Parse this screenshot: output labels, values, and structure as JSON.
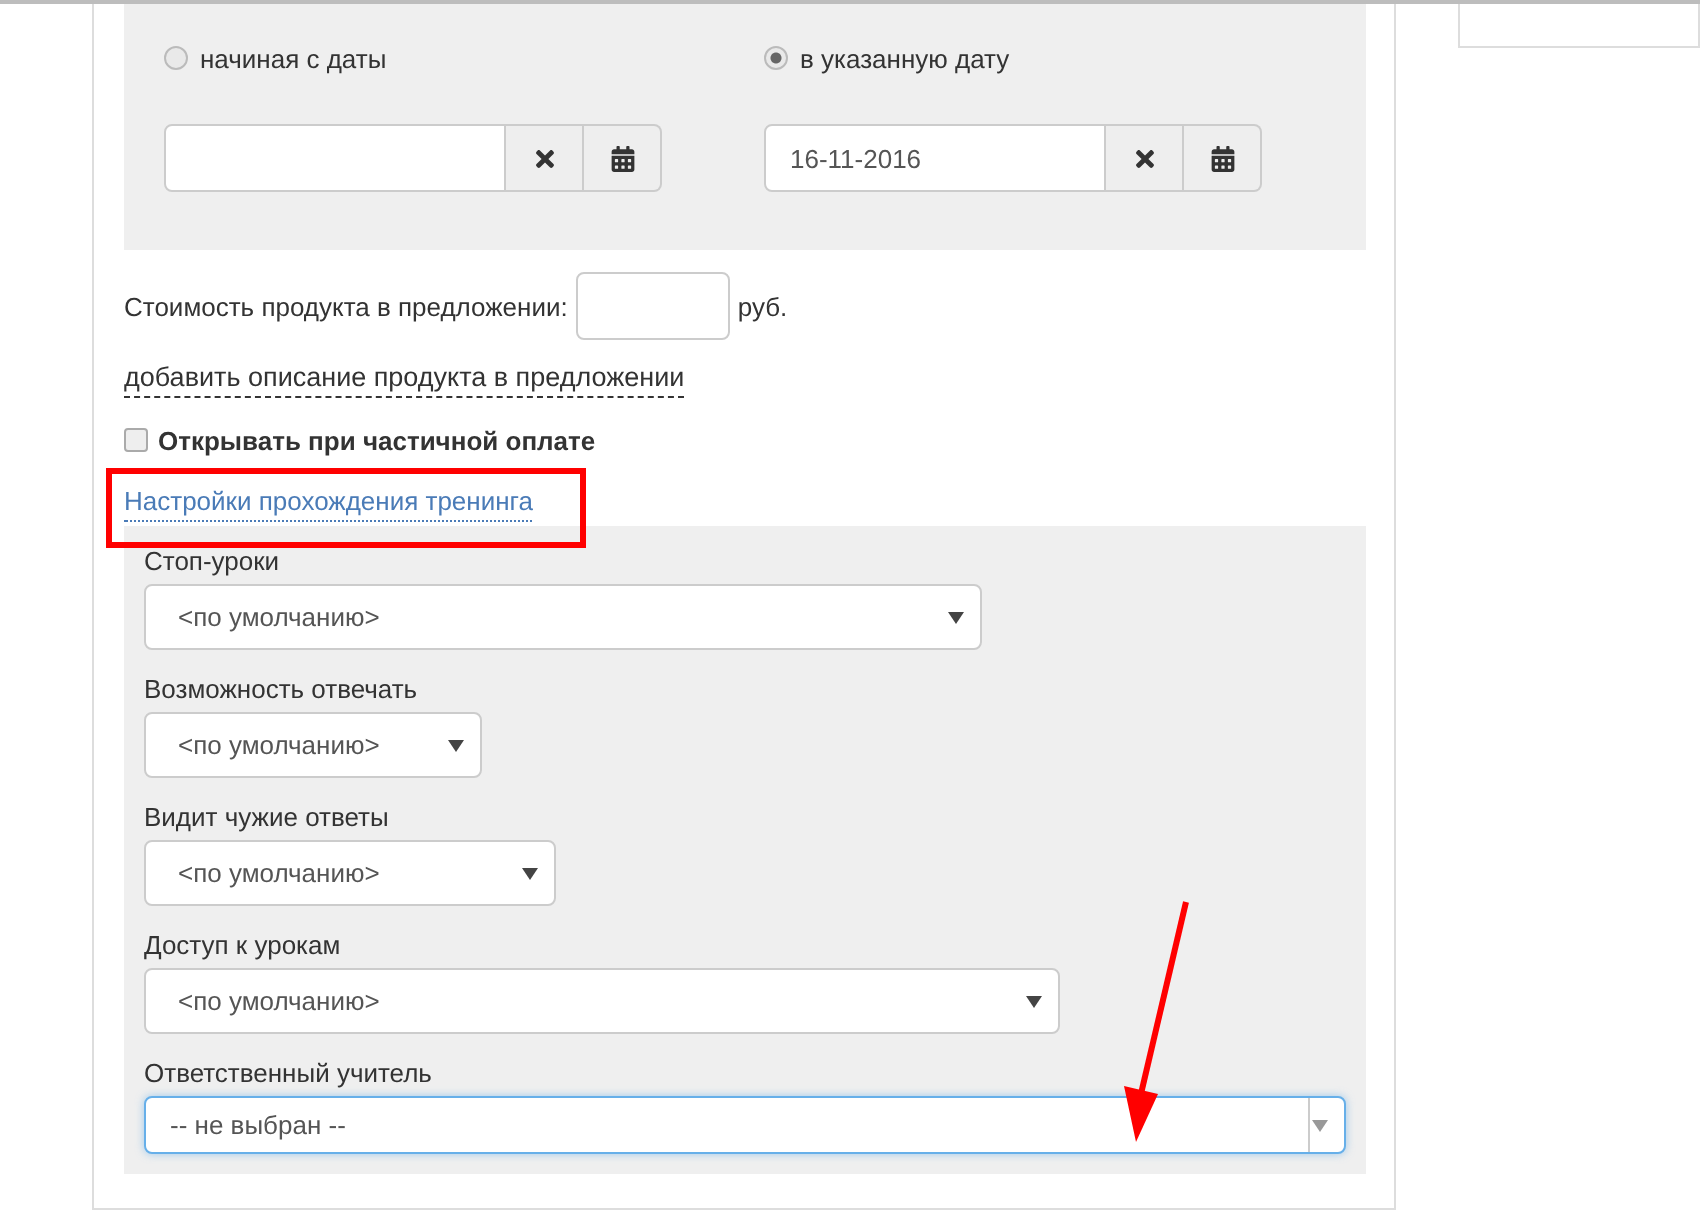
{
  "date_options": [
    {
      "label": "начиная с даты",
      "selected": false
    },
    {
      "label": "в указанную дату",
      "selected": true,
      "value": "16-11-2016"
    }
  ],
  "price": {
    "label": "Стоимость продукта в предложении:",
    "unit": "руб."
  },
  "description_link": "добавить описание продукта в предложении",
  "partial_payment": {
    "label": "Открывать при частичной оплате",
    "checked": false
  },
  "training_settings": {
    "link": "Настройки прохождения тренинга",
    "fields": [
      {
        "label": "Стоп-уроки",
        "value": "<по умолчанию>",
        "kind": "select"
      },
      {
        "label": "Возможность отвечать",
        "value": "<по умолчанию>",
        "kind": "select"
      },
      {
        "label": "Видит чужие ответы",
        "value": "<по умолчанию>",
        "kind": "select"
      },
      {
        "label": "Доступ к урокам",
        "value": "<по умолчанию>",
        "kind": "select"
      },
      {
        "label": "Ответственный учитель",
        "value": "-- не выбран --",
        "kind": "combo"
      }
    ]
  }
}
